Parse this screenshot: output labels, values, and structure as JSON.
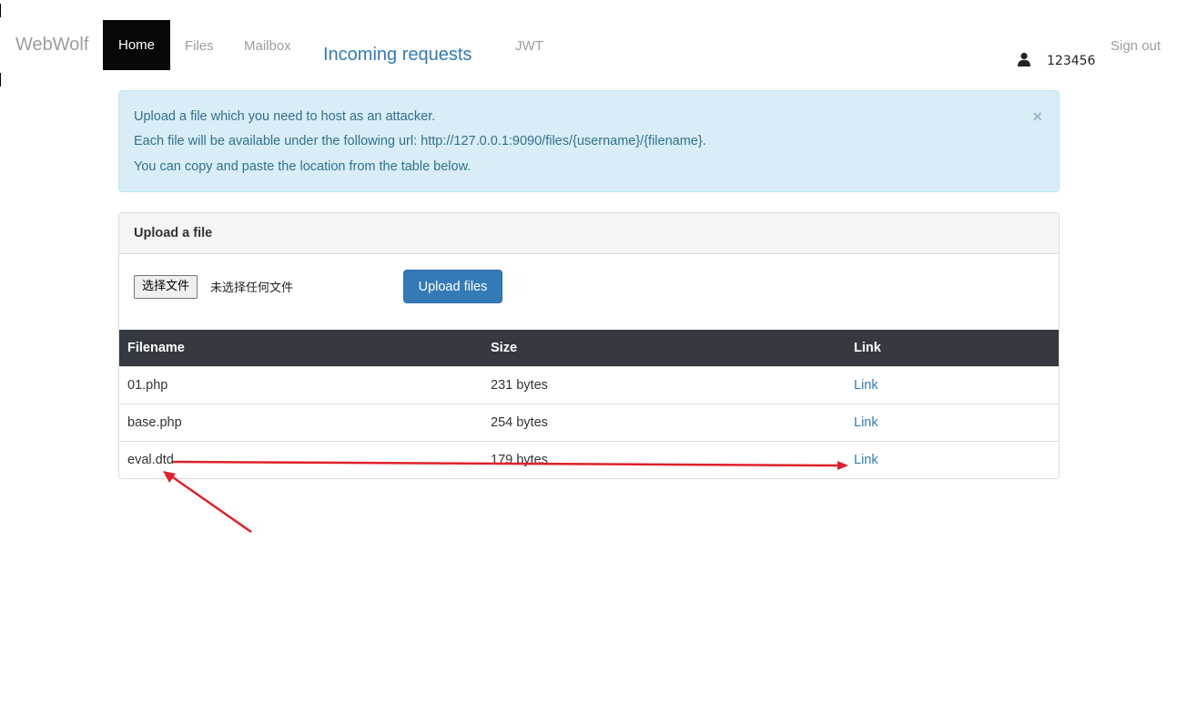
{
  "navbar": {
    "brand": "WebWolf",
    "items": {
      "home": "Home",
      "files": "Files",
      "mailbox": "Mailbox",
      "incoming": "Incoming requests",
      "jwt": "JWT"
    },
    "username": "123456",
    "signout": "Sign out",
    "user_icon": "user-icon",
    "active_bg": "#080808"
  },
  "alert": {
    "line1": "Upload a file which you need to host as an attacker.",
    "line2": "Each file will be available under the following url: http://127.0.0.1:9090/files/{username}/{filename}.",
    "line3": "You can copy and paste the location from the table below.",
    "close": "×",
    "bg_color": "#d9edf7",
    "text_color": "#31708f"
  },
  "upload": {
    "heading": "Upload a file",
    "choose_button": "选择文件",
    "no_file_text": "未选择任何文件",
    "upload_button": "Upload files",
    "button_color": "#337ab7"
  },
  "table": {
    "headers": [
      "Filename",
      "Size",
      "Link"
    ],
    "rows": [
      {
        "filename": "01.php",
        "size": "231 bytes",
        "link": "Link"
      },
      {
        "filename": "base.php",
        "size": "254 bytes",
        "link": "Link"
      },
      {
        "filename": "eval.dtd",
        "size": "179 bytes",
        "link": "Link"
      }
    ],
    "header_bg": "#343a40"
  },
  "annotations": {
    "arrow_color": "#e0202a"
  }
}
